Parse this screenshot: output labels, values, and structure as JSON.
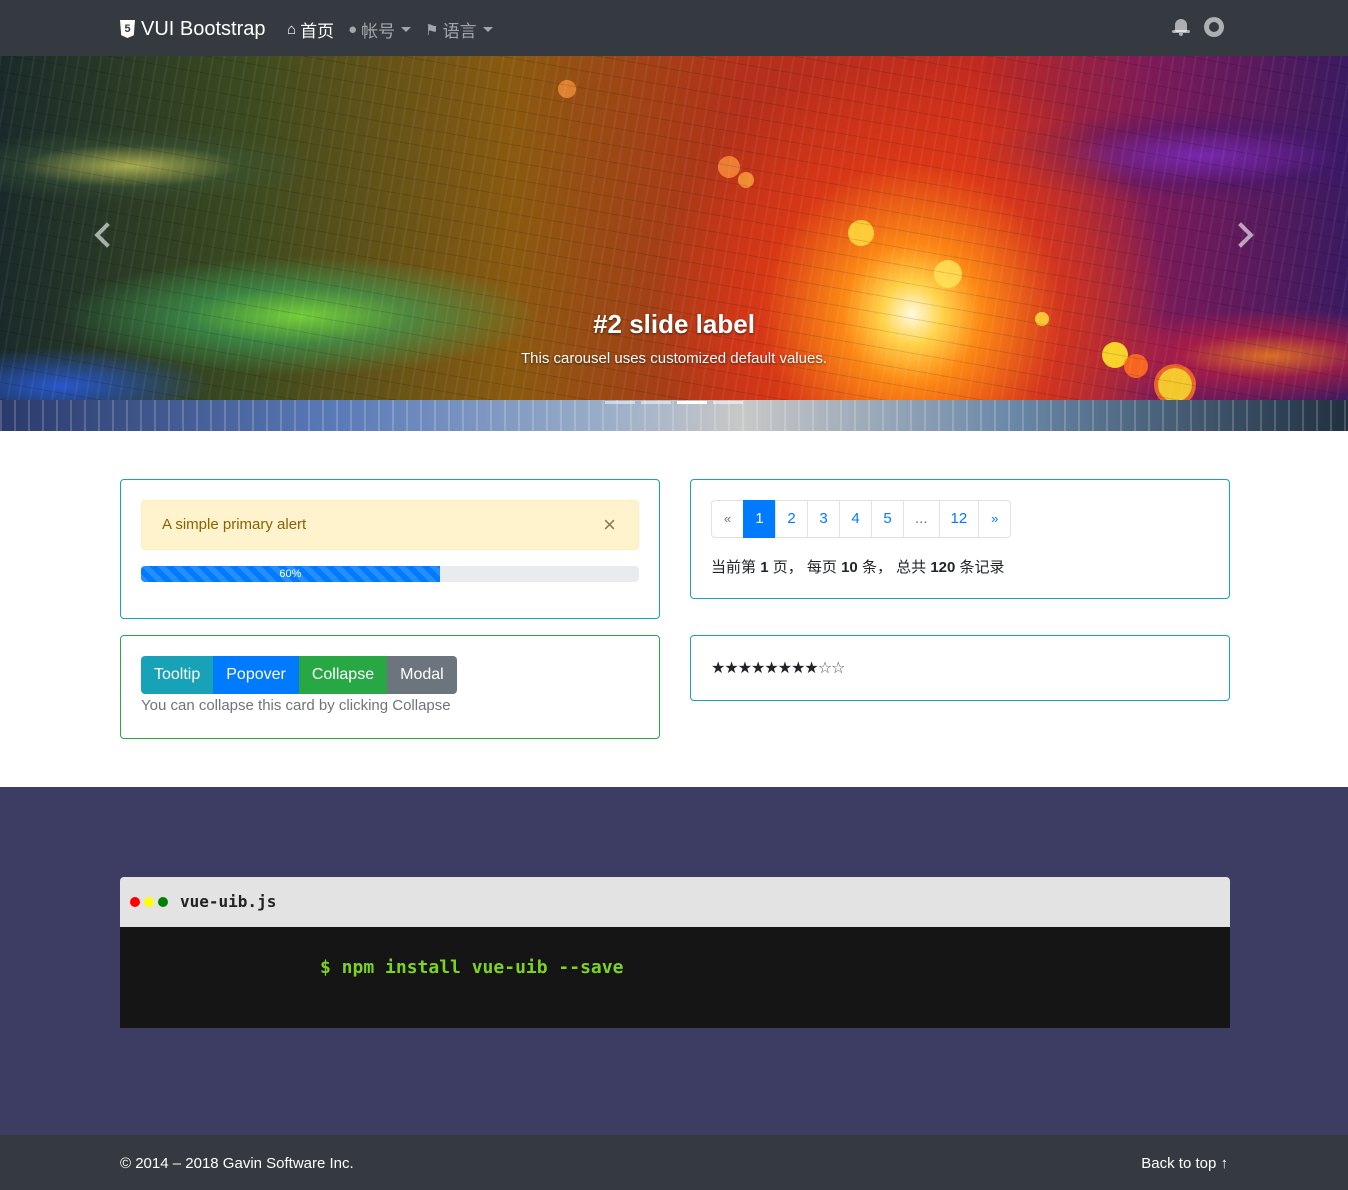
{
  "navbar": {
    "brand": "VUI Bootstrap",
    "brand_icon": "html5-icon",
    "links": [
      {
        "label": "首页",
        "icon": "home-icon",
        "active": true
      },
      {
        "label": "帐号",
        "icon": "user-icon",
        "dropdown": true
      },
      {
        "label": "语言",
        "icon": "flag-icon",
        "dropdown": true
      }
    ],
    "right_icons": [
      "bell-icon",
      "github-icon"
    ]
  },
  "carousel": {
    "title": "#2 slide label",
    "text": "This carousel uses customized default values.",
    "slide_count": 4,
    "active_index": 2
  },
  "alert_card": {
    "alert_text": "A simple primary alert",
    "close_symbol": "×",
    "progress_label": "60%",
    "progress_value": 0.6
  },
  "pagination_card": {
    "pages": [
      "«",
      "1",
      "2",
      "3",
      "4",
      "5",
      "...",
      "12",
      "»"
    ],
    "active_page": "1",
    "info": {
      "prefix": "当前第",
      "current": "1",
      "page_unit": "页，",
      "per_page_label": "每页",
      "per_page": "10",
      "per_page_unit": "条，",
      "total_label": "总共",
      "total": "120",
      "total_unit": "条记录"
    }
  },
  "buttons_card": {
    "buttons": [
      "Tooltip",
      "Popover",
      "Collapse",
      "Modal"
    ],
    "help_text": "You can collapse this card by clicking Collapse"
  },
  "rating_card": {
    "rating": 8,
    "max": 10,
    "filled_text": "★★★★★★★★",
    "empty_text": "☆☆"
  },
  "terminal": {
    "title": "vue-uib.js",
    "command": "$ npm install vue-uib --save",
    "dot_colors": [
      "#ff0000",
      "#ffff00",
      "#008000"
    ]
  },
  "footer": {
    "copyright": "© 2014 – 2018 Gavin Software Inc.",
    "back_to_top": "Back to top ↑"
  },
  "colors": {
    "navbar_bg": "#343a40",
    "primary": "#007bff",
    "info": "#17a2b8",
    "success": "#28a745",
    "secondary": "#6c757d",
    "section_bg": "#3d3d64",
    "terminal_bg": "#151515",
    "terminal_text": "#7ed321"
  }
}
